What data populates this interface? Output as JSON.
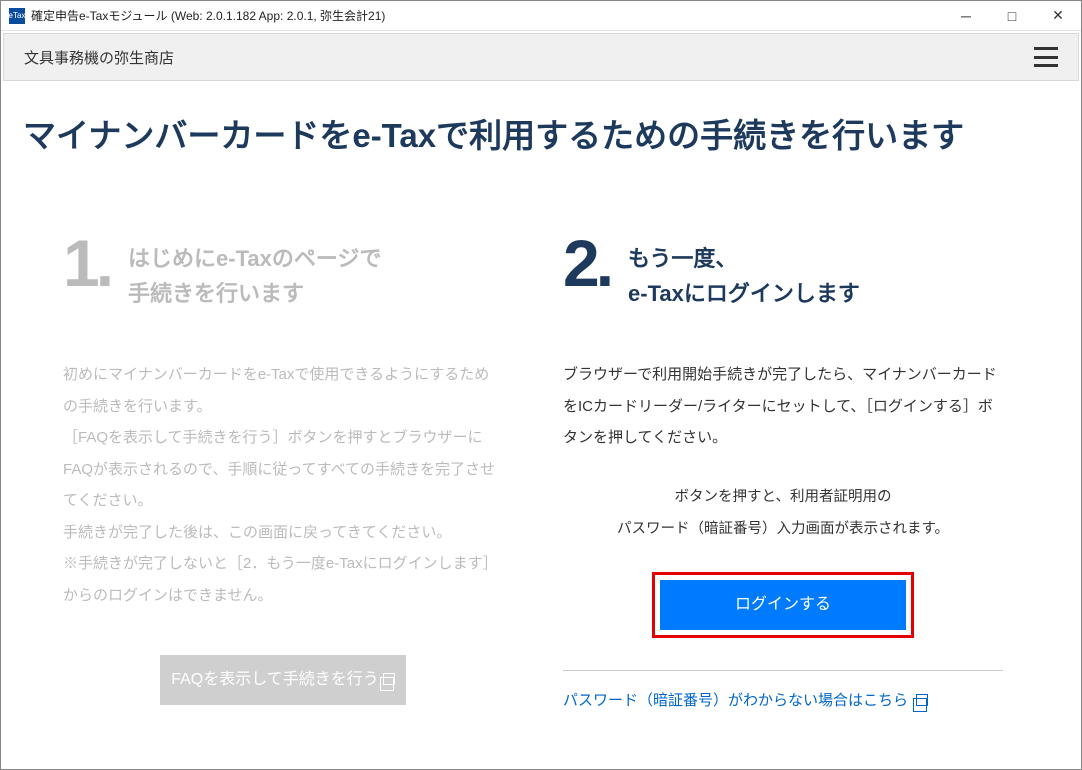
{
  "window": {
    "title": "確定申告e-Taxモジュール (Web: 2.0.1.182 App: 2.0.1, 弥生会計21)",
    "icon_label": "eTax"
  },
  "header": {
    "org_name": "文具事務機の弥生商店"
  },
  "page": {
    "title": "マイナンバーカードをe-Taxで利用するための手続きを行います"
  },
  "step1": {
    "number": "1.",
    "title_line1": "はじめにe-Taxのページで",
    "title_line2": "手続きを行います",
    "body_p1": "初めにマイナンバーカードをe-Taxで使用できるようにするための手続きを行います。",
    "body_p2": "［FAQを表示して手続きを行う］ボタンを押すとブラウザーにFAQが表示されるので、手順に従ってすべての手続きを完了させてください。",
    "body_p3": "手続きが完了した後は、この画面に戻ってきてください。",
    "body_p4": "※手続きが完了しないと［2．もう一度e-Taxにログインします］からのログインはできません。",
    "button_label": "FAQを表示して手続きを行う"
  },
  "step2": {
    "number": "2.",
    "title_line1": "もう一度、",
    "title_line2": "e-Taxにログインします",
    "body_p1": "ブラウザーで利用開始手続きが完了したら、マイナンバーカードをICカードリーダー/ライターにセットして、［ログインする］ボタンを押してください。",
    "hint_line1": "ボタンを押すと、利用者証明用の",
    "hint_line2": "パスワード（暗証番号）入力画面が表示されます。",
    "button_label": "ログインする",
    "link_label": "パスワード（暗証番号）がわからない場合はこちら"
  }
}
